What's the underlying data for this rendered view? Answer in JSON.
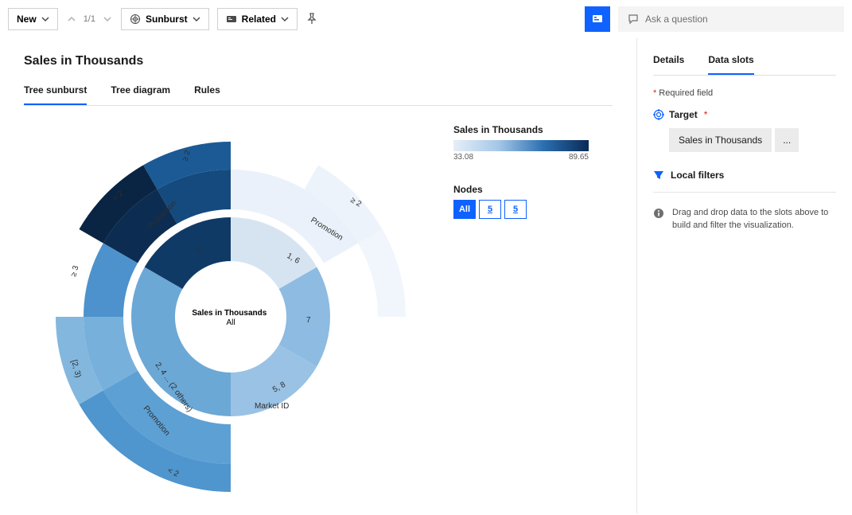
{
  "toolbar": {
    "new_label": "New",
    "pager": "1/1",
    "viz_label": "Sunburst",
    "related_label": "Related",
    "ask_placeholder": "Ask a question"
  },
  "page": {
    "title": "Sales in Thousands",
    "tabs": [
      "Tree sunburst",
      "Tree diagram",
      "Rules"
    ],
    "active_tab": 0
  },
  "legend": {
    "title": "Sales in Thousands",
    "min": "33.08",
    "max": "89.65",
    "nodes_label": "Nodes",
    "node_options": [
      "All",
      "5",
      "5"
    ]
  },
  "right": {
    "tabs": [
      "Details",
      "Data slots"
    ],
    "active_tab": 1,
    "required_label": "Required field",
    "target_label": "Target",
    "target_value": "Sales in Thousands",
    "more_btn": "...",
    "local_filters_label": "Local filters",
    "hint": "Drag and drop data to the slots above to build and filter the visualization."
  },
  "chart_data": {
    "type": "sunburst",
    "title": "Sales in Thousands",
    "legend_measure": "Sales in Thousands",
    "color_scale": {
      "min": 33.08,
      "max": 89.65
    },
    "center": {
      "label": "Sales in Thousands",
      "sublabel": "All"
    },
    "rings": [
      {
        "name": "Market ID",
        "segments": [
          {
            "label": "1, 6",
            "angle_span": 0.17,
            "value": 42
          },
          {
            "label": "3",
            "angle_span": 0.17,
            "value": 86
          },
          {
            "label": "2, 4 ... (2 others)",
            "angle_span": 0.33,
            "value": 55
          },
          {
            "label": "5, 8",
            "angle_span": 0.17,
            "value": 50
          },
          {
            "label": "7",
            "angle_span": 0.17,
            "value": 52
          }
        ]
      },
      {
        "name": "Promotion",
        "segments": [
          {
            "parent": "1, 6",
            "label": "Promotion ≥ 2",
            "angle_span": 0.17,
            "value": 34
          },
          {
            "parent": "3",
            "label": "Promotion ≥ 2",
            "angle_span": 0.085,
            "value": 90,
            "outer": "≥ 2"
          },
          {
            "parent": "3",
            "label": "Promotion < 2",
            "angle_span": 0.085,
            "value": 83,
            "outer": "< 2"
          },
          {
            "parent": "2, 4 ... (2 others)",
            "label": "Promotion [2, 3)",
            "angle_span": 0.165,
            "value": 60,
            "outer": "[2, 3)"
          },
          {
            "parent": "2, 4 ... (2 others)",
            "label": "Promotion ≥ 3",
            "angle_span": 0.082,
            "value": 65,
            "outer": "≥ 3"
          },
          {
            "parent": "2, 4 ... (2 others)",
            "label": "Promotion < 2",
            "angle_span": 0.082,
            "value": 58,
            "outer": "< 2"
          }
        ]
      }
    ]
  }
}
